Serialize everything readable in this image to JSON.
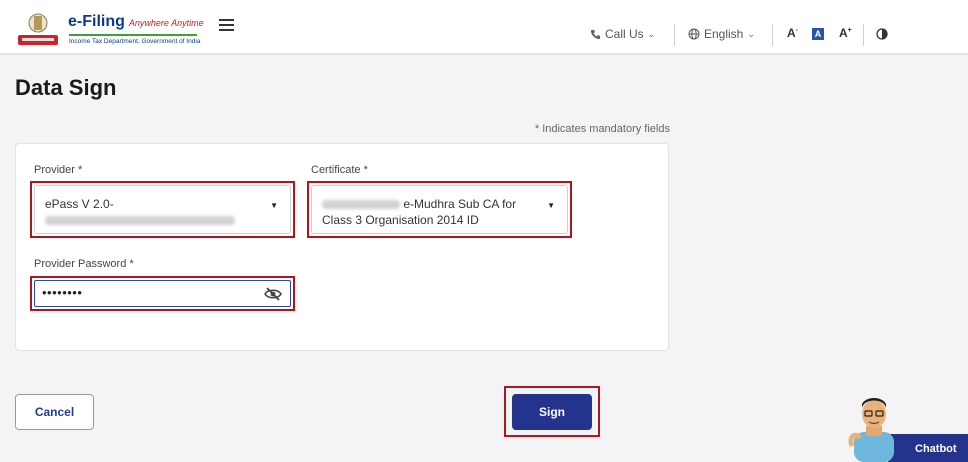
{
  "header": {
    "logo_title": "e-Filing",
    "logo_tagline": "Anywhere Anytime",
    "logo_subtitle": "Income Tax Department, Government of India",
    "call_label": "Call Us",
    "language_label": "English",
    "font_decrease": "A",
    "font_default": "A",
    "font_increase": "A",
    "icons": [
      "emblem-logo",
      "hamburger-menu-icon",
      "phone-icon",
      "globe-icon",
      "chevron-down-icon",
      "contrast-icon"
    ]
  },
  "page": {
    "title": "Data Sign",
    "mandatory_note": "* Indicates mandatory fields"
  },
  "form": {
    "provider": {
      "label": "Provider *",
      "value_line1": "ePass V 2.0-"
    },
    "certificate": {
      "label": "Certificate *",
      "value_line1": "e-Mudhra Sub CA for",
      "value_line2": "Class 3 Organisation 2014 ID"
    },
    "password": {
      "label": "Provider Password *",
      "value": "••••••••"
    }
  },
  "actions": {
    "cancel_label": "Cancel",
    "sign_label": "Sign"
  },
  "chatbot": {
    "label": "Chatbot"
  },
  "colors": {
    "primary": "#24348c",
    "highlight": "#b0141c",
    "background": "#f4f4f6"
  }
}
